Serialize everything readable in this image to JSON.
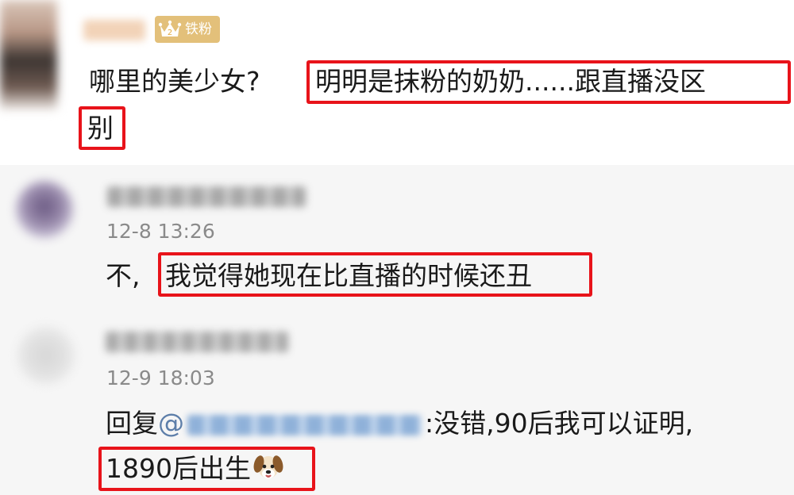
{
  "main_comment": {
    "badge_label": "铁粉",
    "text_prefix": "哪里的美少女?",
    "highlight_line1": "明明是抹粉的奶奶......跟直播没区",
    "highlight_line2": "别"
  },
  "replies": [
    {
      "timestamp": "12-8 13:26",
      "text_prefix": "不,",
      "highlight": "我觉得她现在比直播的时候还丑"
    },
    {
      "timestamp": "12-9 18:03",
      "reply_prefix": "回复",
      "mention_at": "@",
      "text_after_mention": ":没错,90后我可以证明,",
      "highlight": "1890后出生",
      "emoji_icon": "dog-face-icon"
    }
  ],
  "colors": {
    "highlight_border": "#e8131a",
    "badge_bg": "#e3c07a",
    "mention": "#5d7ea9",
    "timestamp": "#8a8a8a"
  }
}
